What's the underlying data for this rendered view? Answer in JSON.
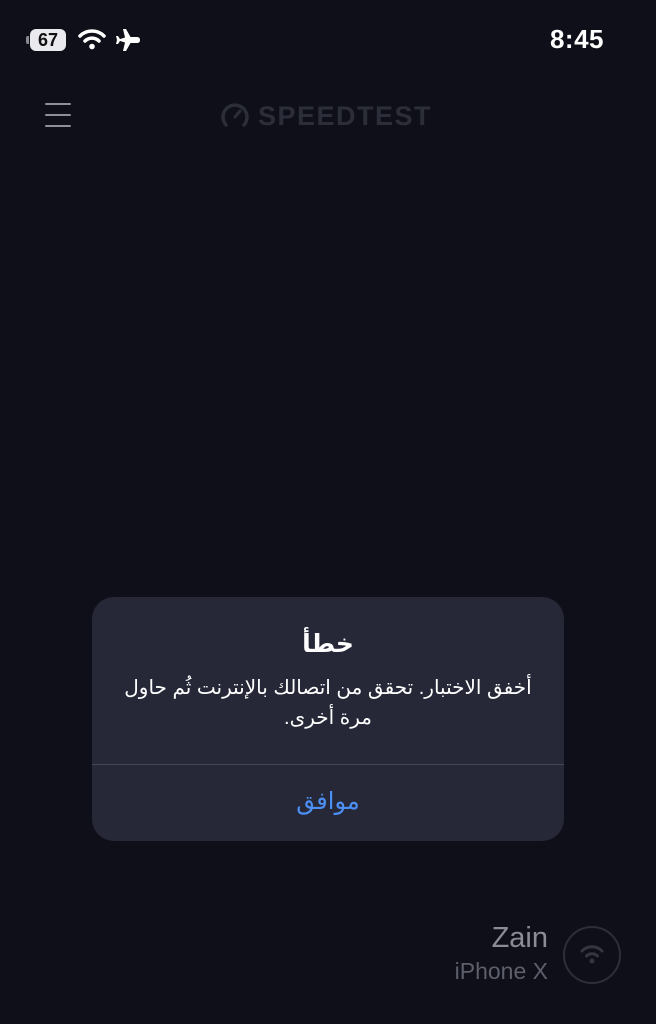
{
  "status_bar": {
    "battery": "67",
    "time": "8:45"
  },
  "app": {
    "brand": "SPEEDTEST"
  },
  "alert": {
    "title": "خطأ",
    "message": "أخفق الاختبار. تحقق من اتصالك بالإنترنت ثُم حاول مرة أخرى.",
    "ok_button": "موافق"
  },
  "provider": {
    "name": "Zain",
    "device": "iPhone X"
  },
  "colors": {
    "background": "#0e0f18",
    "alert_background": "#262838",
    "accent": "#4c8ff5"
  }
}
